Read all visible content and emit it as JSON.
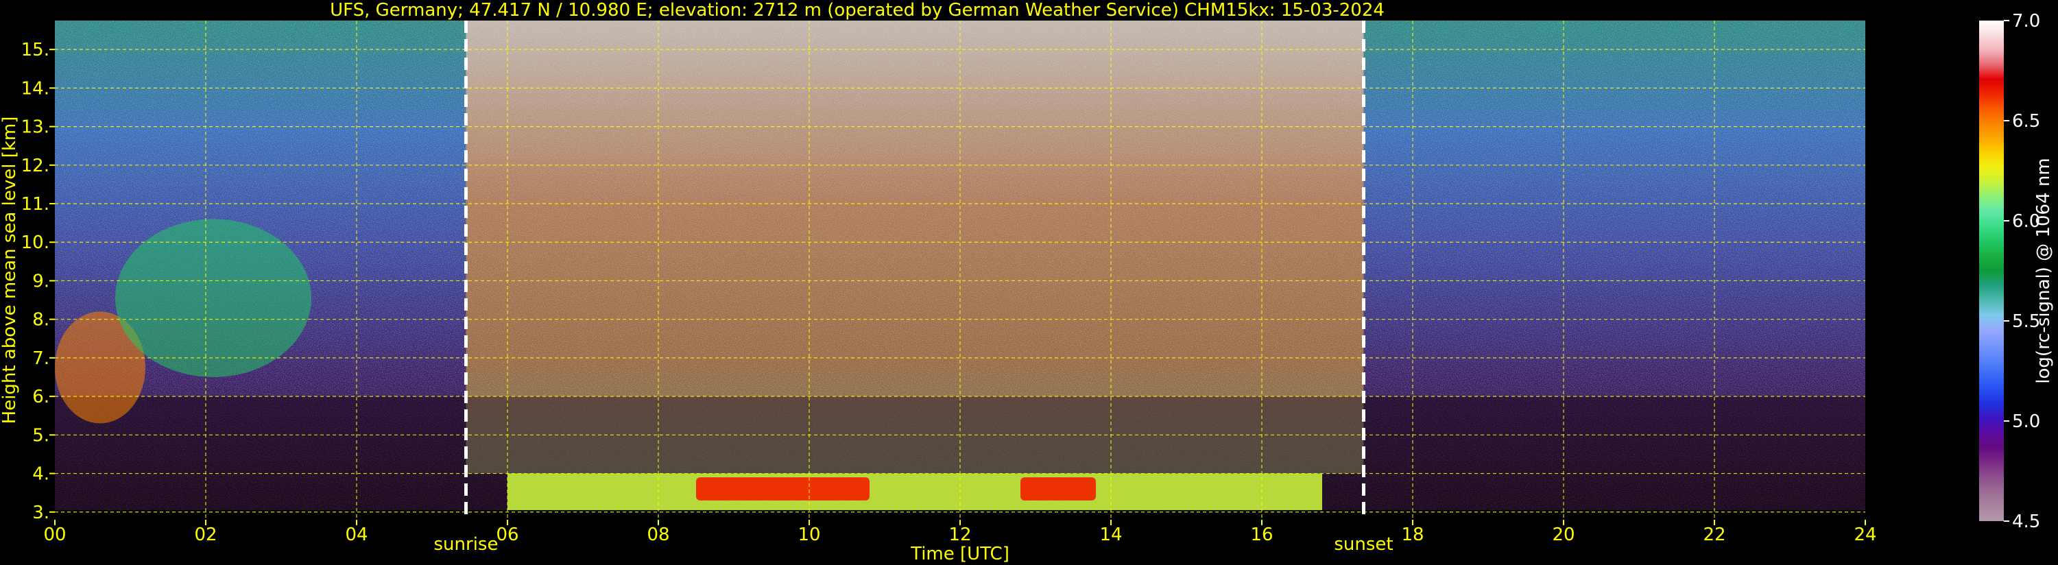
{
  "chart_data": {
    "type": "heatmap",
    "title": "UFS, Germany; 47.417 N / 10.980 E; elevation: 2712 m  (operated by German Weather Service)    CHM15kx: 15-03-2024",
    "xlabel": "Time [UTC]",
    "ylabel": "Height above mean sea level [km]",
    "xlim": [
      0,
      24
    ],
    "ylim": [
      2.8,
      15.75
    ],
    "x_ticks": [
      "00",
      "02",
      "04",
      "06",
      "08",
      "10",
      "12",
      "14",
      "16",
      "18",
      "20",
      "22",
      "24"
    ],
    "x_tick_values": [
      0,
      2,
      4,
      6,
      8,
      10,
      12,
      14,
      16,
      18,
      20,
      22,
      24
    ],
    "y_ticks": [
      "3.",
      "4.",
      "5.",
      "6.",
      "7.",
      "8.",
      "9.",
      "10.",
      "11.",
      "12.",
      "13.",
      "14.",
      "15."
    ],
    "y_tick_values": [
      3,
      4,
      5,
      6,
      7,
      8,
      9,
      10,
      11,
      12,
      13,
      14,
      15
    ],
    "grid": true,
    "events": [
      {
        "label": "sunrise",
        "time": 5.45
      },
      {
        "label": "sunset",
        "time": 17.35
      }
    ],
    "colorbar": {
      "label": "log(rc-signal) @ 1064 nm",
      "ticks": [
        "4.5",
        "5.0",
        "5.5",
        "6.0",
        "6.5",
        "7.0"
      ],
      "tick_values": [
        4.5,
        5.0,
        5.5,
        6.0,
        6.5,
        7.0
      ],
      "range": [
        4.5,
        7.0
      ],
      "colors": [
        "#b49aad",
        "#a8849e",
        "#9c6d95",
        "#8d4f8d",
        "#7a2a88",
        "#650a82",
        "#5a0aa0",
        "#3c14c0",
        "#1e32e0",
        "#2850f0",
        "#3c6cf8",
        "#5a84fa",
        "#7896fb",
        "#96aafc",
        "#7ec8ea",
        "#4eb8b0",
        "#22a080",
        "#0e9a3c",
        "#1ab040",
        "#22c864",
        "#3cdc88",
        "#60e8a8",
        "#88f07a",
        "#c8f03c",
        "#f0f014",
        "#fcd000",
        "#fca800",
        "#fc8400",
        "#fa5a00",
        "#f02800",
        "#e00000",
        "#e86a74",
        "#f2b4ba",
        "#f8dcdc",
        "#ffffff"
      ]
    },
    "features": [
      {
        "kind": "cloud",
        "t_start": 0.0,
        "t_end": 1.2,
        "h_bottom": 5.3,
        "h_top": 8.2,
        "level": 6.5
      },
      {
        "kind": "cloud",
        "t_start": 0.8,
        "t_end": 3.4,
        "h_bottom": 6.5,
        "h_top": 10.6,
        "level": 5.9
      },
      {
        "kind": "boundary-layer",
        "t_start": 6.0,
        "t_end": 16.8,
        "h_bottom": 3.0,
        "h_top": 4.0,
        "level": 6.2
      },
      {
        "kind": "boundary-layer-core",
        "t_start": 8.5,
        "t_end": 10.8,
        "h_bottom": 3.3,
        "h_top": 3.9,
        "level": 6.6
      },
      {
        "kind": "boundary-layer-core",
        "t_start": 12.8,
        "t_end": 13.8,
        "h_bottom": 3.3,
        "h_top": 3.9,
        "level": 6.6
      },
      {
        "kind": "daylight-noise",
        "t_start": 5.45,
        "t_end": 17.35,
        "h_bottom": 4.0,
        "h_top": 15.75,
        "level": 6.9
      }
    ]
  }
}
